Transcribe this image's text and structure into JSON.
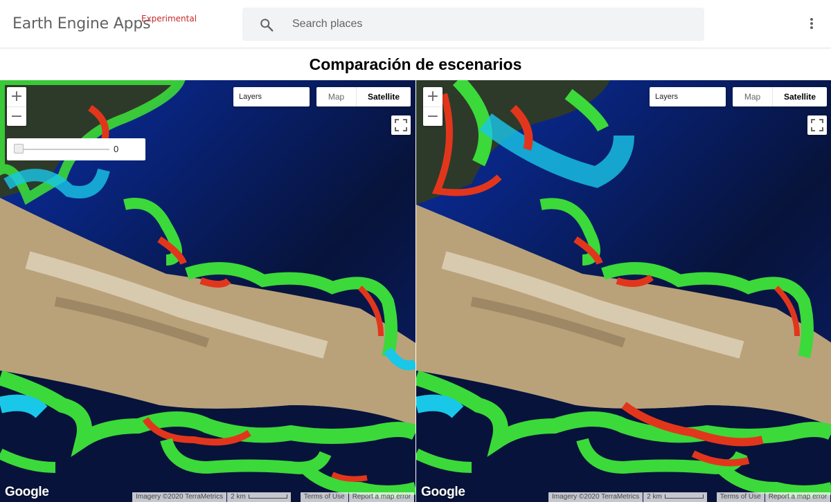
{
  "header": {
    "brand": "Earth Engine Apps",
    "tag": "Experimental",
    "search_placeholder": "Search places",
    "search_icon": "search-icon",
    "menu_icon": "more-vert-icon"
  },
  "page": {
    "title": "Comparación de escenarios"
  },
  "map_controls": {
    "zoom_in": "+",
    "zoom_out": "−",
    "layers_label": "Layers",
    "map_label": "Map",
    "satellite_label": "Satellite",
    "fullscreen_icon": "fullscreen-icon"
  },
  "slider": {
    "value": "0"
  },
  "footer": {
    "google": "Google",
    "imagery": "Imagery ©2020 TerraMetrics",
    "scale": "2 km",
    "terms": "Terms of Use",
    "report": "Report a map error"
  },
  "colors": {
    "experimental": "#c62828",
    "water_dark": "#07133a",
    "water_mid": "#0a2fa8",
    "cyan": "#19c7e8",
    "green": "#3cd93a",
    "red": "#e2361c",
    "terrain": "#c9b48e"
  }
}
